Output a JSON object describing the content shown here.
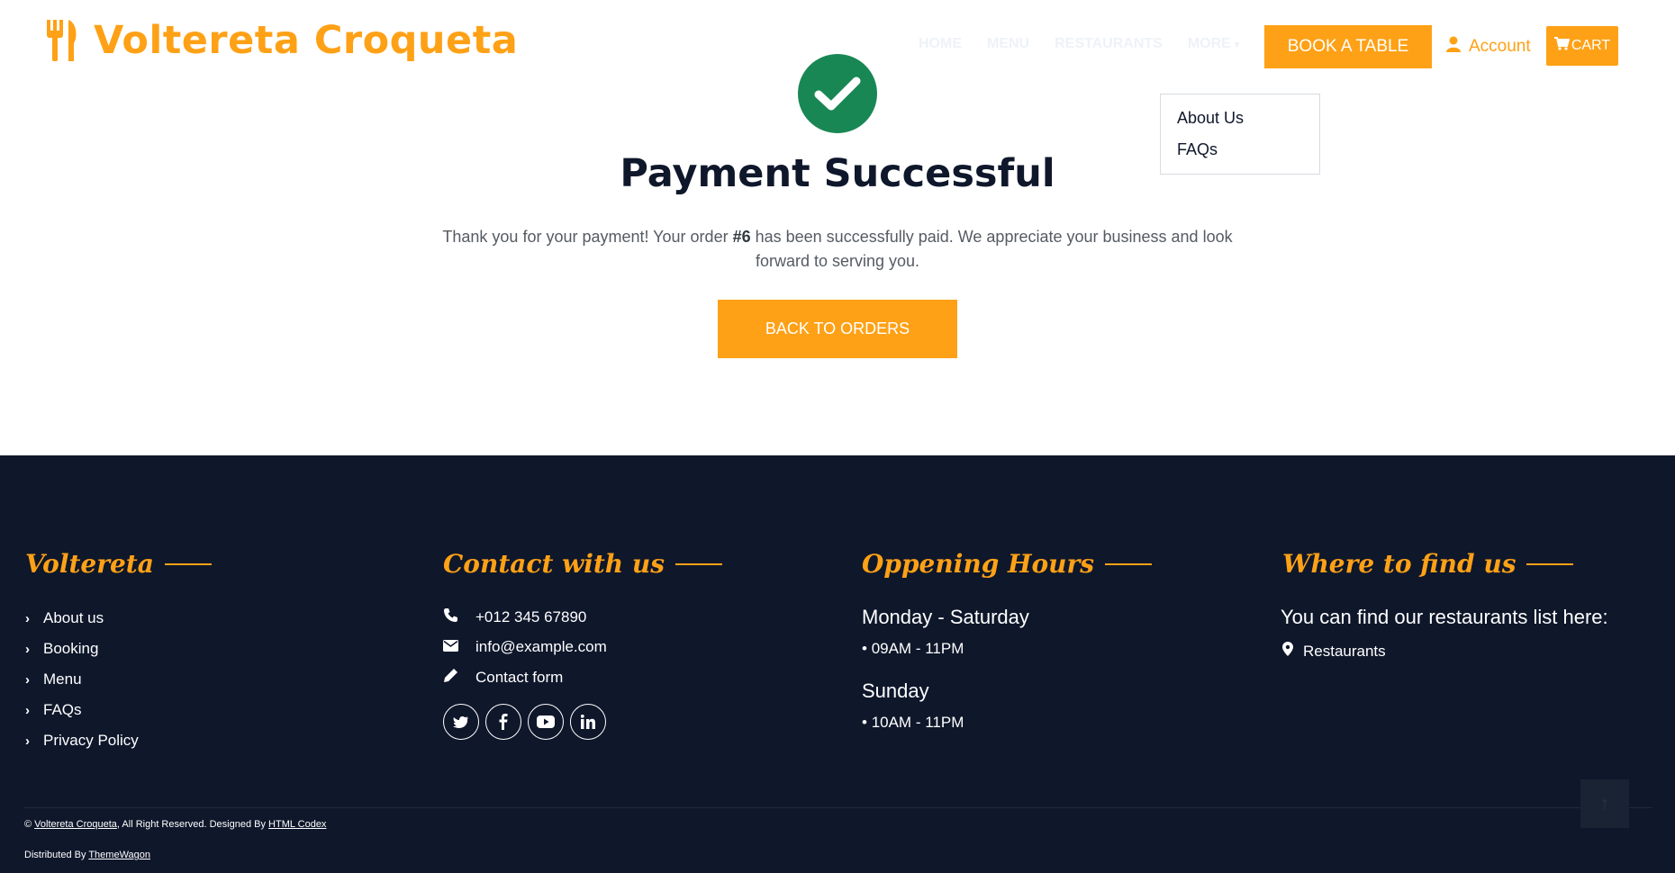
{
  "brand": {
    "name": "Voltereta Croqueta",
    "icon": "utensils-icon"
  },
  "nav": {
    "links": [
      "HOME",
      "MENU",
      "RESTAURANTS",
      "MORE"
    ],
    "book_label": "BOOK A TABLE",
    "account_label": "Account",
    "cart_label": "CART",
    "dropdown": [
      "About Us",
      "FAQs"
    ]
  },
  "success": {
    "title": "Payment Successful",
    "message_before": "Thank you for your payment! Your order ",
    "order_ref": "#6",
    "message_after": " has been successfully paid. We appreciate your business and look forward to serving you.",
    "back_label": "BACK TO ORDERS"
  },
  "footer": {
    "col1": {
      "title": "Voltereta",
      "links": [
        "About us",
        "Booking",
        "Menu",
        "FAQs",
        "Privacy Policy"
      ]
    },
    "col2": {
      "title": "Contact with us",
      "phone": "+012 345 67890",
      "email": "info@example.com",
      "form": "Contact form",
      "social": [
        "twitter-icon",
        "facebook-icon",
        "youtube-icon",
        "linkedin-icon"
      ]
    },
    "col3": {
      "title": "Oppening Hours",
      "day1": "Monday - Saturday",
      "hours1": "09AM - 11PM",
      "day2": "Sunday",
      "hours2": "10AM - 11PM"
    },
    "col4": {
      "title": "Where to find us",
      "intro": "You can find our restaurants list here:",
      "link": "Restaurants"
    },
    "copyright": {
      "symbol": "©",
      "brand": "Voltereta Croqueta",
      "rights": ", All Right Reserved. Designed By ",
      "designer": "HTML Codex",
      "distributed": "Distributed By ",
      "distributor": "ThemeWagon"
    }
  },
  "colors": {
    "accent": "#fea116",
    "dark": "#0f172b",
    "success": "#198754"
  }
}
